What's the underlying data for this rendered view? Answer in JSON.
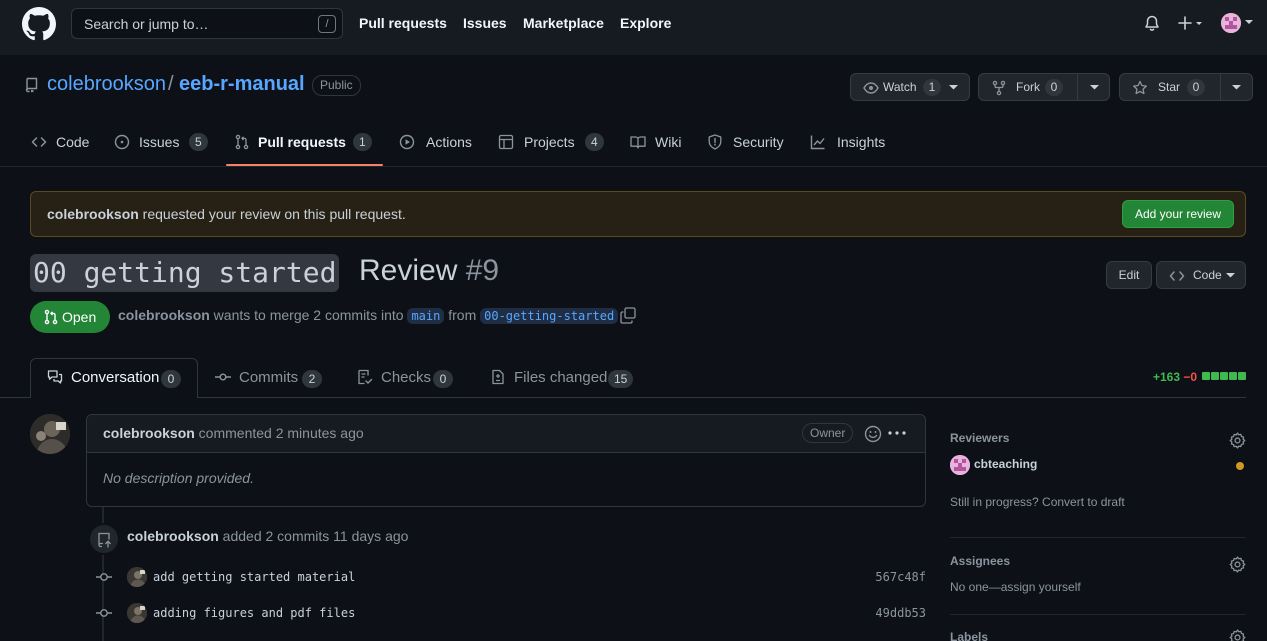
{
  "header": {
    "search_placeholder": "Search or jump to…",
    "search_shortcut": "/",
    "nav": [
      "Pull requests",
      "Issues",
      "Marketplace",
      "Explore"
    ]
  },
  "repo": {
    "owner": "colebrookson",
    "separator": "/",
    "name": "eeb-r-manual",
    "visibility": "Public",
    "watch": {
      "label": "Watch",
      "count": "1"
    },
    "fork": {
      "label": "Fork",
      "count": "0"
    },
    "star": {
      "label": "Star",
      "count": "0"
    }
  },
  "repo_tabs": [
    {
      "label": "Code",
      "count": ""
    },
    {
      "label": "Issues",
      "count": "5"
    },
    {
      "label": "Pull requests",
      "count": "1"
    },
    {
      "label": "Actions",
      "count": ""
    },
    {
      "label": "Projects",
      "count": "4"
    },
    {
      "label": "Wiki",
      "count": ""
    },
    {
      "label": "Security",
      "count": ""
    },
    {
      "label": "Insights",
      "count": ""
    }
  ],
  "banner": {
    "user": "colebrookson",
    "text": " requested your review on this pull request.",
    "button": "Add your review"
  },
  "pr": {
    "title_code": "00 getting started",
    "title_rest": "Review",
    "number": "#9",
    "edit_label": "Edit",
    "code_label": "Code",
    "state": "Open",
    "author": "colebrookson",
    "merge_text": " wants to merge 2 commits into ",
    "base_branch": "main",
    "from_text": " from ",
    "head_branch": "00-getting-started"
  },
  "pr_tabs": [
    {
      "label": "Conversation",
      "count": "0"
    },
    {
      "label": "Commits",
      "count": "2"
    },
    {
      "label": "Checks",
      "count": "0"
    },
    {
      "label": "Files changed",
      "count": "15"
    }
  ],
  "diffstat": {
    "additions": "+163",
    "deletions": "−0"
  },
  "comment": {
    "author": "colebrookson",
    "action": " commented 2 minutes ago",
    "role": "Owner",
    "body": "No description provided."
  },
  "timeline": {
    "author": "colebrookson",
    "action": " added 2 commits 11 days ago",
    "commits": [
      {
        "message": "add getting started material",
        "sha": "567c48f"
      },
      {
        "message": "adding figures and pdf files",
        "sha": "49ddb53"
      }
    ]
  },
  "sidebar": {
    "reviewers_title": "Reviewers",
    "reviewer": "cbteaching",
    "draft_text": "Still in progress? Convert to draft",
    "assignees_title": "Assignees",
    "assignees_text": "No one—assign yourself",
    "labels_title": "Labels"
  }
}
